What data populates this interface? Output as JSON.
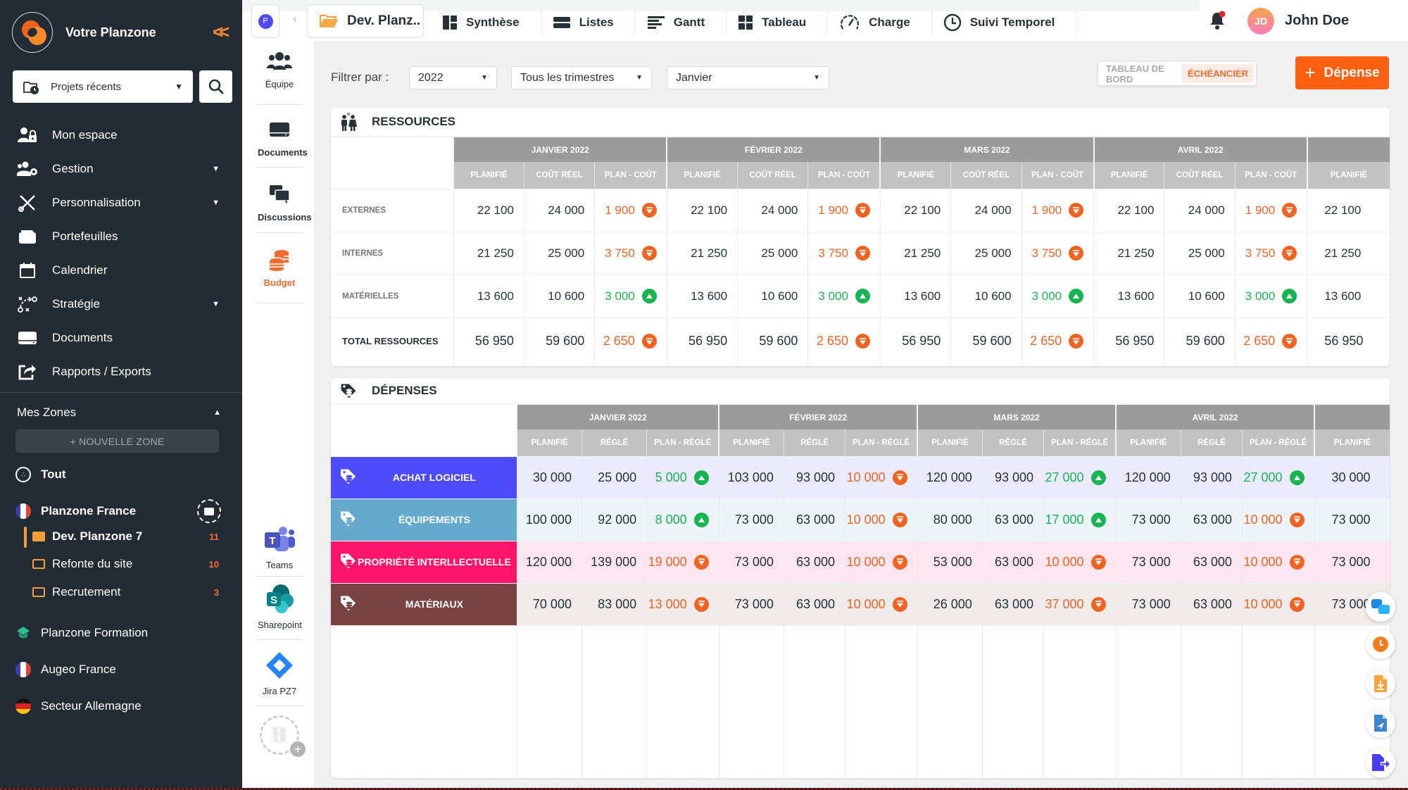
{
  "sidebar": {
    "app_name": "Votre Planzone",
    "recent_projects": "Projets récents",
    "nav": [
      {
        "label": "Mon espace",
        "icon": "user-lock-icon",
        "expandable": false
      },
      {
        "label": "Gestion",
        "icon": "users-gear-icon",
        "expandable": true
      },
      {
        "label": "Personnalisation",
        "icon": "tools-icon",
        "expandable": true
      },
      {
        "label": "Portefeuilles",
        "icon": "wallet-icon",
        "expandable": false
      },
      {
        "label": "Calendrier",
        "icon": "calendar-icon",
        "expandable": false
      },
      {
        "label": "Stratégie",
        "icon": "strategy-icon",
        "expandable": true
      },
      {
        "label": "Documents",
        "icon": "drive-icon",
        "expandable": false
      },
      {
        "label": "Rapports / Exports",
        "icon": "export-icon",
        "expandable": false
      }
    ],
    "zones_title": "Mes Zones",
    "new_zone": "+ NOUVELLE ZONE",
    "zones": [
      {
        "label": "Tout",
        "icon": "all-zones-icon"
      },
      {
        "label": "Planzone France",
        "icon": "flag-france-icon"
      },
      {
        "label": "Planzone Formation",
        "icon": "graduation-icon"
      },
      {
        "label": "Augeo France",
        "icon": "flag-france-icon"
      },
      {
        "label": "Secteur Allemagne",
        "icon": "flag-germany-icon"
      }
    ],
    "projects": [
      {
        "label": "Dev. Planzone 7",
        "count": "11",
        "active": true
      },
      {
        "label": "Refonte du site",
        "count": "10",
        "active": false
      },
      {
        "label": "Recrutement",
        "count": "3",
        "active": false
      }
    ]
  },
  "tools": {
    "items": [
      {
        "label": "Équipe",
        "icon": "team-icon"
      },
      {
        "label": "Documents",
        "icon": "drive-icon"
      },
      {
        "label": "Discussions",
        "icon": "chat-icon"
      },
      {
        "label": "Budget",
        "icon": "coins-icon",
        "active": true
      }
    ],
    "integrations": [
      {
        "label": "Teams",
        "icon": "teams-icon"
      },
      {
        "label": "Sharepoint",
        "icon": "sharepoint-icon"
      },
      {
        "label": "Jira PZ7",
        "icon": "jira-icon"
      }
    ]
  },
  "topbar": {
    "avatar_letter": "P",
    "project": "Dev. Planz..",
    "tabs": [
      {
        "label": "Synthèse",
        "icon": "synthesis-icon"
      },
      {
        "label": "Listes",
        "icon": "list-icon"
      },
      {
        "label": "Gantt",
        "icon": "gantt-icon"
      },
      {
        "label": "Tableau",
        "icon": "board-icon"
      },
      {
        "label": "Charge",
        "icon": "gauge-icon"
      },
      {
        "label": "Suivi Temporel",
        "icon": "clock-icon"
      }
    ],
    "user_initials": "JD",
    "user_name": "John Doe"
  },
  "filters": {
    "label": "Filtrer par :",
    "year": "2022",
    "quarter": "Tous les trimestres",
    "month": "Janvier"
  },
  "view_toggle": {
    "dashboard": "TABLEAU DE BORD",
    "schedule": "ÉCHÉANCIER",
    "active": "schedule"
  },
  "add_button": "Dépense",
  "colors": {
    "accent": "#fd6011",
    "negative": "#f26322",
    "positive": "#16b552",
    "sidebar": "#232c34"
  },
  "resources": {
    "title": "RESSOURCES",
    "months": [
      "JANVIER 2022",
      "FÉVRIER 2022",
      "MARS 2022",
      "AVRIL 2022"
    ],
    "subcols": [
      "PLANIFIÉ",
      "COÛT RÉEL",
      "PLAN - COÛT"
    ],
    "rows": [
      {
        "label": "EXTERNES",
        "total": false,
        "cells": [
          [
            "22 100",
            "24 000",
            "1 900",
            "neg"
          ],
          [
            "22 100",
            "24 000",
            "1 900",
            "neg"
          ],
          [
            "22 100",
            "24 000",
            "1 900",
            "neg"
          ],
          [
            "22 100",
            "24 000",
            "1 900",
            "neg"
          ]
        ],
        "next": "22 100"
      },
      {
        "label": "INTERNES",
        "total": false,
        "cells": [
          [
            "21 250",
            "25 000",
            "3 750",
            "neg"
          ],
          [
            "21 250",
            "25 000",
            "3 750",
            "neg"
          ],
          [
            "21 250",
            "25 000",
            "3 750",
            "neg"
          ],
          [
            "21 250",
            "25 000",
            "3 750",
            "neg"
          ]
        ],
        "next": "21 250"
      },
      {
        "label": "MATÉRIELLES",
        "total": false,
        "cells": [
          [
            "13 600",
            "10 600",
            "3 000",
            "pos"
          ],
          [
            "13 600",
            "10 600",
            "3 000",
            "pos"
          ],
          [
            "13 600",
            "10 600",
            "3 000",
            "pos"
          ],
          [
            "13 600",
            "10 600",
            "3 000",
            "pos"
          ]
        ],
        "next": "13 600"
      },
      {
        "label": "TOTAL RESSOURCES",
        "total": true,
        "cells": [
          [
            "56 950",
            "59 600",
            "2 650",
            "neg"
          ],
          [
            "56 950",
            "59 600",
            "2 650",
            "neg"
          ],
          [
            "56 950",
            "59 600",
            "2 650",
            "neg"
          ],
          [
            "56 950",
            "59 600",
            "2 650",
            "neg"
          ]
        ],
        "next": "56 950"
      }
    ]
  },
  "expenses": {
    "title": "DÉPENSES",
    "months": [
      "JANVIER 2022",
      "FÉVRIER 2022",
      "MARS 2022",
      "AVRIL 2022"
    ],
    "subcols": [
      "PLANIFIÉ",
      "RÉGLÉ",
      "PLAN - RÉGLÉ"
    ],
    "rows": [
      {
        "label": "ACHAT LOGICIEL",
        "color": "#4e4bfb",
        "tint": "#ebebfd",
        "cells": [
          [
            "30 000",
            "25 000",
            "5 000",
            "pos"
          ],
          [
            "103 000",
            "93 000",
            "10 000",
            "neg"
          ],
          [
            "120 000",
            "93 000",
            "27 000",
            "pos"
          ],
          [
            "120 000",
            "93 000",
            "27 000",
            "pos"
          ]
        ],
        "next": "30 000"
      },
      {
        "label": "ÉQUIPEMENTS",
        "color": "#65a9cd",
        "tint": "#eef5f9",
        "cells": [
          [
            "100 000",
            "92 000",
            "8 000",
            "pos"
          ],
          [
            "73 000",
            "63 000",
            "10 000",
            "neg"
          ],
          [
            "80 000",
            "63 000",
            "17 000",
            "pos"
          ],
          [
            "73 000",
            "63 000",
            "10 000",
            "neg"
          ]
        ],
        "next": "73 000"
      },
      {
        "label": "PROPRIÉTÉ INTERLLECTUELLE",
        "color": "#fd156b",
        "tint": "#fde6ef",
        "cells": [
          [
            "120 000",
            "139 000",
            "19 000",
            "neg"
          ],
          [
            "73 000",
            "63 000",
            "10 000",
            "neg"
          ],
          [
            "53 000",
            "63 000",
            "10 000",
            "neg"
          ],
          [
            "73 000",
            "63 000",
            "10 000",
            "neg"
          ]
        ],
        "next": "73 000"
      },
      {
        "label": "MATÉRIAUX",
        "color": "#7a4343",
        "tint": "#f1eaea",
        "cells": [
          [
            "70 000",
            "83 000",
            "13 000",
            "neg"
          ],
          [
            "73 000",
            "63 000",
            "10 000",
            "neg"
          ],
          [
            "26 000",
            "63 000",
            "37 000",
            "neg"
          ],
          [
            "73 000",
            "63 000",
            "10 000",
            "neg"
          ]
        ],
        "next": "73 000"
      }
    ]
  },
  "floating_actions": [
    {
      "name": "switch-icon"
    },
    {
      "name": "timer-icon"
    },
    {
      "name": "file-download-icon"
    },
    {
      "name": "file-send-icon"
    },
    {
      "name": "file-export-icon"
    }
  ]
}
